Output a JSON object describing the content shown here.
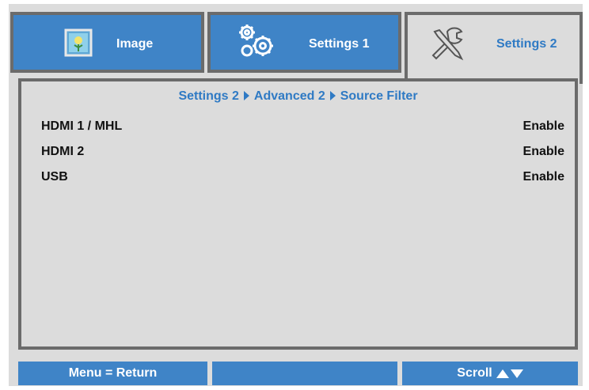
{
  "tabs": [
    {
      "label": "Image",
      "icon": "image-icon",
      "active": false
    },
    {
      "label": "Settings 1",
      "icon": "gears-icon",
      "active": false
    },
    {
      "label": "Settings 2",
      "icon": "tools-icon",
      "active": true
    }
  ],
  "breadcrumb": [
    "Settings 2",
    "Advanced 2",
    "Source Filter"
  ],
  "rows": [
    {
      "name": "HDMI 1 / MHL",
      "value": "Enable"
    },
    {
      "name": "HDMI 2",
      "value": "Enable"
    },
    {
      "name": "USB",
      "value": "Enable"
    }
  ],
  "footer": {
    "left": "Menu = Return",
    "middle": "",
    "right": "Scroll"
  },
  "colors": {
    "accent": "#3f84c7",
    "panel": "#dcdcdc",
    "border": "#6b6b6b",
    "highlight_text": "#2f7ac4"
  }
}
